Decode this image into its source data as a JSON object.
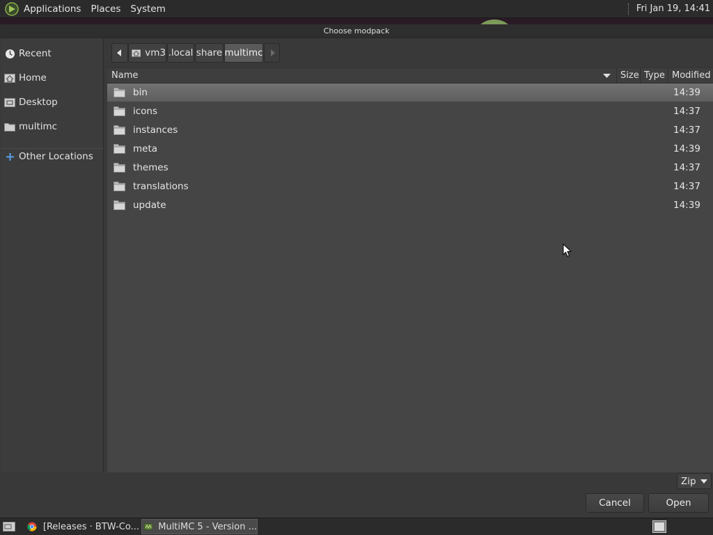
{
  "top_panel": {
    "menus": [
      "Applications",
      "Places",
      "System"
    ],
    "clock": "Fri Jan 19, 14:41"
  },
  "dialog": {
    "title": "Choose modpack"
  },
  "sidebar": {
    "items": [
      {
        "label": "Recent",
        "icon": "recent-icon"
      },
      {
        "label": "Home",
        "icon": "home-icon"
      },
      {
        "label": "Desktop",
        "icon": "desktop-icon"
      },
      {
        "label": "multimc",
        "icon": "folder-icon"
      },
      {
        "label": "Other Locations",
        "icon": "plus-icon"
      }
    ]
  },
  "pathbar": {
    "crumbs": [
      "vm3",
      ".local",
      "share",
      "multimc"
    ],
    "active": "multimc"
  },
  "file_list": {
    "columns": [
      "Name",
      "Size",
      "Type",
      "Modified"
    ],
    "sort_column": "Name",
    "rows": [
      {
        "name": "bin",
        "size": "",
        "type": "",
        "modified": "14:39",
        "selected": true
      },
      {
        "name": "icons",
        "size": "",
        "type": "",
        "modified": "14:37"
      },
      {
        "name": "instances",
        "size": "",
        "type": "",
        "modified": "14:37"
      },
      {
        "name": "meta",
        "size": "",
        "type": "",
        "modified": "14:39"
      },
      {
        "name": "themes",
        "size": "",
        "type": "",
        "modified": "14:37"
      },
      {
        "name": "translations",
        "size": "",
        "type": "",
        "modified": "14:37"
      },
      {
        "name": "update",
        "size": "",
        "type": "",
        "modified": "14:39"
      }
    ]
  },
  "footer": {
    "filter": "Zip",
    "cancel": "Cancel",
    "open": "Open"
  },
  "taskbar": {
    "tasks": [
      {
        "label": "[Releases · BTW-Co...",
        "icon": "chrome-icon"
      },
      {
        "label": "MultiMC 5 - Version ...",
        "icon": "multimc-icon",
        "active": true
      }
    ]
  },
  "colors": {
    "panel": "#2b2b2b",
    "dialog_bg": "#393939",
    "list_bg": "#454545",
    "selection": "#6a6a6a"
  }
}
